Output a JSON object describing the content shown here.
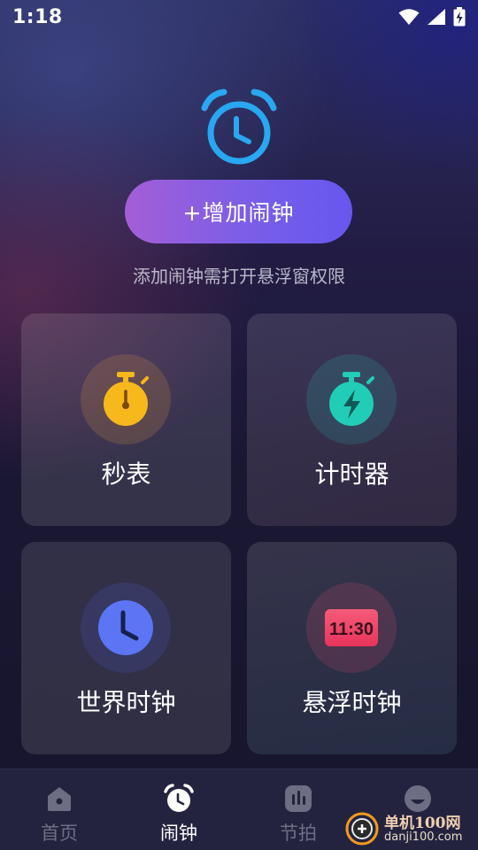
{
  "status_bar": {
    "time": "1:18",
    "icons": [
      "wifi-icon",
      "cellular-signal-icon",
      "battery-charging-icon"
    ]
  },
  "hero": {
    "icon": "alarm-clock-icon",
    "icon_color": "#29a7f0",
    "add_alarm_label": "+增加闹钟",
    "permission_hint": "添加闹钟需打开悬浮窗权限"
  },
  "tiles": [
    {
      "label": "秒表",
      "icon": "stopwatch-icon",
      "icon_color": "#f6b81a"
    },
    {
      "label": "计时器",
      "icon": "timer-bolt-icon",
      "icon_color": "#21cdb7"
    },
    {
      "label": "世界时钟",
      "icon": "world-clock-icon",
      "icon_color": "#5b75f5"
    },
    {
      "label": "悬浮时钟",
      "icon": "floating-clock-icon",
      "icon_color": "#f0466c",
      "icon_text": "11:30"
    }
  ],
  "bottom_nav": {
    "items": [
      {
        "label": "首页",
        "icon": "home-icon",
        "active": false
      },
      {
        "label": "闹钟",
        "icon": "alarm-clock-icon",
        "active": true
      },
      {
        "label": "节拍",
        "icon": "metronome-icon",
        "active": false
      },
      {
        "label": "",
        "icon": "profile-icon",
        "active": false
      }
    ]
  },
  "watermark": {
    "line1": "单机100网",
    "line2": "danji100.com"
  }
}
